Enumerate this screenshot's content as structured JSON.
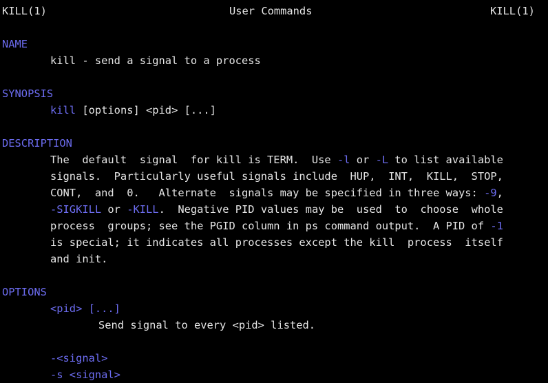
{
  "header": {
    "left": "KILL(1)",
    "center": "User Commands",
    "right": "KILL(1)"
  },
  "name_section": {
    "heading": "NAME",
    "text": "kill - send a signal to a process"
  },
  "synopsis_section": {
    "heading": "SYNOPSIS",
    "command": "kill",
    "args": " [options] <pid> [...]"
  },
  "description_section": {
    "heading": "DESCRIPTION",
    "lines": [
      [
        {
          "t": "The  default  signal  for kill is TERM.  Use ",
          "hl": false
        },
        {
          "t": "-l",
          "hl": true
        },
        {
          "t": " or ",
          "hl": false
        },
        {
          "t": "-L",
          "hl": true
        },
        {
          "t": " to list available",
          "hl": false
        }
      ],
      [
        {
          "t": "signals.  Particularly useful signals include  HUP,  INT,  KILL,  STOP,",
          "hl": false
        }
      ],
      [
        {
          "t": "CONT,  and  0.   Alternate  signals may be specified in three ways: ",
          "hl": false
        },
        {
          "t": "-9",
          "hl": true
        },
        {
          "t": ",",
          "hl": false
        }
      ],
      [
        {
          "t": "-SIGKILL",
          "hl": true
        },
        {
          "t": " or ",
          "hl": false
        },
        {
          "t": "-KILL",
          "hl": true
        },
        {
          "t": ".  Negative PID values may be  used  to  choose  whole",
          "hl": false
        }
      ],
      [
        {
          "t": "process  groups; see the PGID column in ps command output.  A PID of ",
          "hl": false
        },
        {
          "t": "-1",
          "hl": true
        }
      ],
      [
        {
          "t": "is special; it indicates all processes except the kill  process  itself",
          "hl": false
        }
      ],
      [
        {
          "t": "and init.",
          "hl": false
        }
      ]
    ]
  },
  "options_section": {
    "heading": "OPTIONS",
    "items": [
      {
        "term": "<pid> [...]",
        "desc": "Send signal to every <pid> listed."
      },
      {
        "term": "-<signal>",
        "desc": ""
      },
      {
        "term": "-s <signal>",
        "desc": ""
      }
    ]
  },
  "colors": {
    "background": "#000000",
    "text": "#e6e6e6",
    "highlight": "#6c6cf0"
  }
}
